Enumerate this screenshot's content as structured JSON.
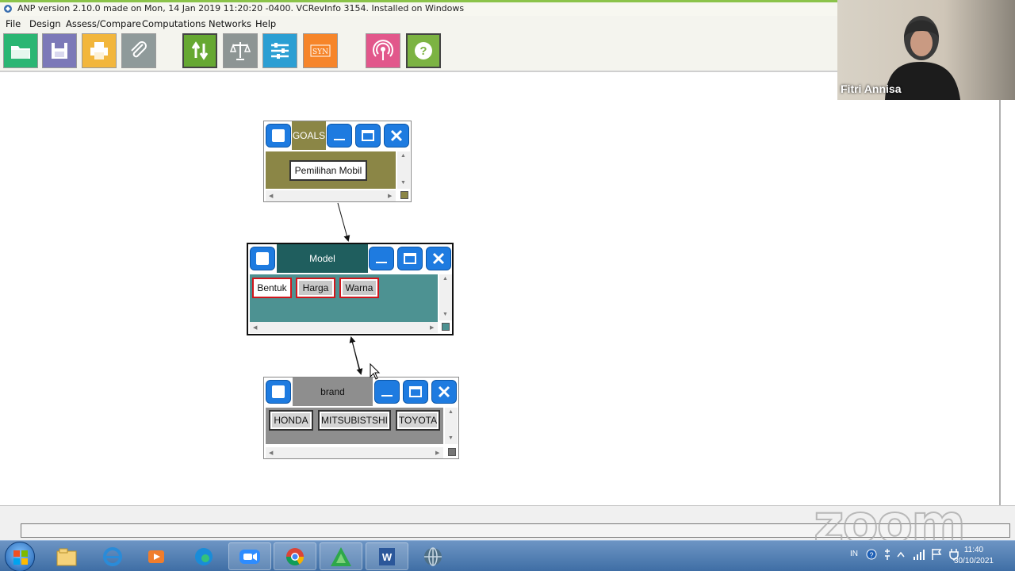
{
  "window": {
    "title": "ANP version 2.10.0 made on Mon, 14 Jan 2019 11:20:20 -0400.  VCRevInfo 3154.  Installed on Windows"
  },
  "menu": [
    "File",
    "Design",
    "Assess/Compare",
    "Computations",
    "Networks",
    "Help"
  ],
  "toolbar": {
    "buttons": [
      {
        "icon": "open-folder-icon",
        "color": "#2bb673"
      },
      {
        "icon": "save-icon",
        "color": "#7c79b8"
      },
      {
        "icon": "print-icon",
        "color": "#f2b63c"
      },
      {
        "icon": "attach-icon",
        "color": "#8f9a9a"
      },
      {
        "icon": "update-arrows-icon",
        "color": "#66a832"
      },
      {
        "icon": "balance-scale-icon",
        "color": "#8d9594"
      },
      {
        "icon": "sliders-icon",
        "color": "#2b9fd3"
      },
      {
        "icon": "syn-icon",
        "label": "SYN",
        "color": "#f6852a"
      },
      {
        "icon": "sensitivity-icon",
        "color": "#e2578b"
      },
      {
        "icon": "help-icon",
        "color": "#7cb342"
      }
    ]
  },
  "clusters": {
    "goals": {
      "name": "GOALS",
      "color": "#8b8646",
      "nodes": [
        "Pemilihan Mobil"
      ]
    },
    "model": {
      "name": "Model",
      "color": "#1f5e5e",
      "body_color": "#4d9292",
      "nodes": [
        "Bentuk",
        "Harga",
        "Warna"
      ],
      "selected_border_color": "#d0161c"
    },
    "brand": {
      "name": "brand",
      "color": "#8e8e8e",
      "nodes": [
        "HONDA",
        "MITSUBISTSHI",
        "TOYOTA"
      ]
    }
  },
  "video_overlay": {
    "participant_name": "Fitri Annisa"
  },
  "watermark": "zoom",
  "taskbar": {
    "apps": [
      {
        "icon": "explorer-icon"
      },
      {
        "icon": "internet-explorer-icon"
      },
      {
        "icon": "media-player-icon"
      },
      {
        "icon": "edge-icon"
      },
      {
        "icon": "zoom-icon"
      },
      {
        "icon": "chrome-icon"
      },
      {
        "icon": "anp-superdecisions-icon"
      },
      {
        "icon": "word-icon"
      },
      {
        "icon": "globe-icon"
      }
    ],
    "language": "IN",
    "time": "11:40",
    "date": "30/10/2021"
  }
}
